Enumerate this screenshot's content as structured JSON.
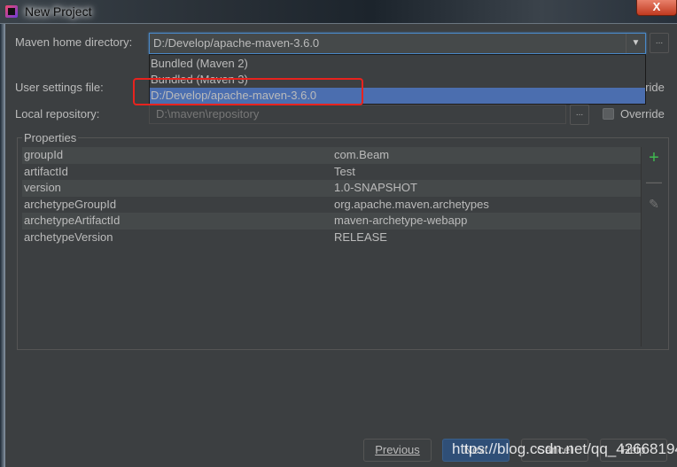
{
  "window": {
    "title": "New Project",
    "close_label": "X"
  },
  "form": {
    "maven_home_label": "Maven home directory:",
    "maven_home_value": "D:/Develop/apache-maven-3.6.0",
    "dropdown_options": [
      "Bundled (Maven 2)",
      "Bundled (Maven 3)",
      "D:/Develop/apache-maven-3.6.0"
    ],
    "selected_option": "D:/Develop/apache-maven-3.6.0",
    "user_settings_label": "User settings file:",
    "user_settings_override": "Override",
    "local_repo_label": "Local repository:",
    "local_repo_value": "D:\\maven\\repository",
    "local_repo_override": "Override",
    "browse_label": "...",
    "dropdown_arrow": "▼"
  },
  "properties": {
    "title": "Properties",
    "rows": [
      {
        "key": "groupId",
        "value": "com.Beam"
      },
      {
        "key": "artifactId",
        "value": "Test"
      },
      {
        "key": "version",
        "value": "1.0-SNAPSHOT"
      },
      {
        "key": "archetypeGroupId",
        "value": "org.apache.maven.archetypes"
      },
      {
        "key": "archetypeArtifactId",
        "value": "maven-archetype-webapp"
      },
      {
        "key": "archetypeVersion",
        "value": "RELEASE"
      }
    ],
    "add_color": "#3fb950"
  },
  "buttons": {
    "previous": "Previous",
    "next": "Next",
    "cancel": "Cancel",
    "help": "Help"
  },
  "watermark": "https://blog.csdn.net/qq_42668194",
  "colors": {
    "selection": "#4b6eaf",
    "highlight_box": "#e8231e",
    "background": "#3c3f41"
  }
}
